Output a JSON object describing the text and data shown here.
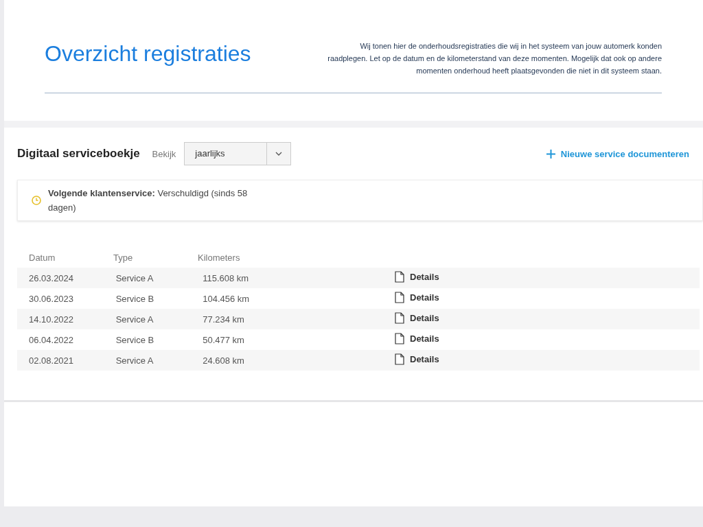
{
  "header": {
    "title": "Overzicht registraties",
    "description": "Wij tonen hier de onderhoudsregistraties die wij in het systeem van jouw automerk konden raadplegen. Let op de datum en de kilometerstand van deze momenten. Mogelijk dat ook op andere momenten onderhoud heeft plaatsgevonden die niet in dit systeem staan."
  },
  "servicebook": {
    "title": "Digitaal serviceboekje",
    "view_label": "Bekijk",
    "view_select": "jaarlijks",
    "add_link": "Nieuwe service documenteren",
    "notice": "**Volgende klantenservice:** Verschuldigd (sinds 58 dagen)",
    "table": {
      "columns": [
        "Datum",
        "Type",
        "Kilometers"
      ],
      "rows": [
        {
          "date": "26.03.2024",
          "type": "Service A",
          "km": "115.608 km",
          "action": "Details"
        },
        {
          "date": "30.06.2023",
          "type": "Service B",
          "km": "104.456 km",
          "action": "Details"
        },
        {
          "date": "14.10.2022",
          "type": "Service A",
          "km": "77.234 km",
          "action": "Details"
        },
        {
          "date": "06.04.2022",
          "type": "Service B",
          "km": "50.477 km",
          "action": "Details"
        },
        {
          "date": "02.08.2021",
          "type": "Service A",
          "km": "24.608 km",
          "action": "Details"
        }
      ]
    }
  }
}
